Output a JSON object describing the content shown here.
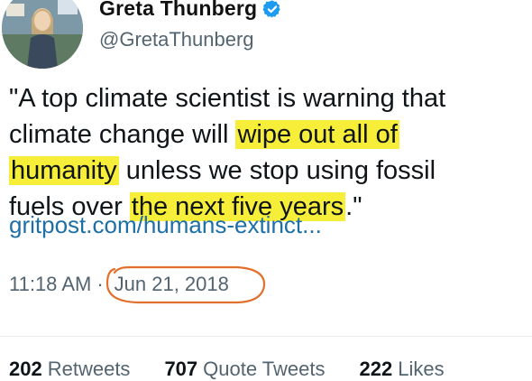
{
  "profile": {
    "name": "Greta Thunberg",
    "handle": "@GretaThunberg",
    "verified": true,
    "verified_color": "#1d9bf0"
  },
  "tweet": {
    "lines": [
      [
        {
          "text": "\"A top climate scientist is warning that",
          "hl": false
        }
      ],
      [
        {
          "text": "climate change will ",
          "hl": false
        },
        {
          "text": "wipe out all of",
          "hl": true
        }
      ],
      [
        {
          "text": "humanity",
          "hl": true
        },
        {
          "text": " unless we stop using fossil",
          "hl": false
        }
      ],
      [
        {
          "text": "fuels over ",
          "hl": false
        },
        {
          "text": "the next five years",
          "hl": true
        },
        {
          "text": ".\"",
          "hl": false
        }
      ]
    ],
    "link": "gritpost.com/humans-extinct...",
    "highlight_color": "#f7ee3a"
  },
  "meta": {
    "time": "11:18 AM",
    "separator": "·",
    "date": "Jun 21, 2018",
    "annotation_color": "#e0702c"
  },
  "stats": {
    "retweets_count": "202",
    "retweets_label": "Retweets",
    "quotes_count": "707",
    "quotes_label": "Quote Tweets",
    "likes_count": "222",
    "likes_label": "Likes"
  }
}
